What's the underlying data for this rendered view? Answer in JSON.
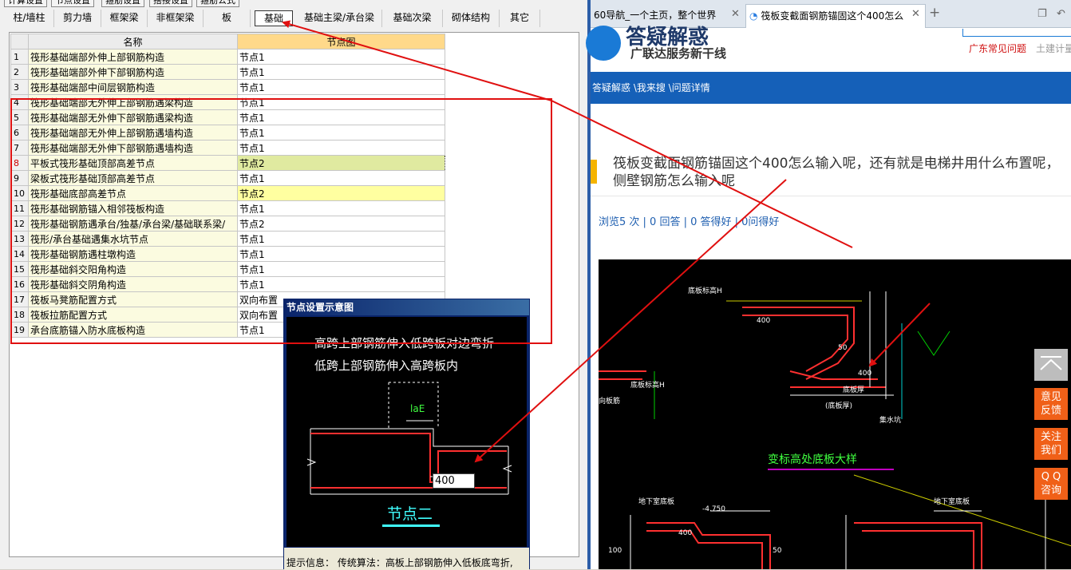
{
  "app": {
    "top_tabs": [
      "计算设置",
      "节点设置",
      "箍筋设置",
      "搭接设置",
      "箍筋公式"
    ],
    "category_tabs": [
      "柱/墙柱",
      "剪力墙",
      "框架梁",
      "非框架梁",
      "板",
      "基础",
      "基础主梁/承台梁",
      "基础次梁",
      "砌体结构",
      "其它"
    ],
    "active_category": "基础",
    "grid": {
      "col_name": "名称",
      "col_node": "节点图",
      "rows": [
        {
          "n": "1",
          "name": "筏形基础端部外伸上部钢筋构造",
          "val": "节点1"
        },
        {
          "n": "2",
          "name": "筏形基础端部外伸下部钢筋构造",
          "val": "节点1"
        },
        {
          "n": "3",
          "name": "筏形基础端部中间层钢筋构造",
          "val": "节点1"
        },
        {
          "n": "4",
          "name": "筏形基础端部无外伸上部钢筋遇梁构造",
          "val": "节点1"
        },
        {
          "n": "5",
          "name": "筏形基础端部无外伸下部钢筋遇梁构造",
          "val": "节点1"
        },
        {
          "n": "6",
          "name": "筏形基础端部无外伸上部钢筋遇墙构造",
          "val": "节点1"
        },
        {
          "n": "7",
          "name": "筏形基础端部无外伸下部钢筋遇墙构造",
          "val": "节点1"
        },
        {
          "n": "8",
          "name": "平板式筏形基础顶部高差节点",
          "val": "节点2"
        },
        {
          "n": "9",
          "name": "梁板式筏形基础顶部高差节点",
          "val": "节点1"
        },
        {
          "n": "10",
          "name": "筏形基础底部高差节点",
          "val": "节点2"
        },
        {
          "n": "11",
          "name": "筏形基础钢筋锚入相邻筏板构造",
          "val": "节点1"
        },
        {
          "n": "12",
          "name": "筏形基础钢筋遇承台/独基/承台梁/基础联系梁/",
          "val": "节点2"
        },
        {
          "n": "13",
          "name": "筏形/承台基础遇集水坑节点",
          "val": "节点1"
        },
        {
          "n": "14",
          "name": "筏形基础钢筋遇柱墩构造",
          "val": "节点1"
        },
        {
          "n": "15",
          "name": "筏形基础斜交阳角构造",
          "val": "节点1"
        },
        {
          "n": "16",
          "name": "筏形基础斜交阴角构造",
          "val": "节点1"
        },
        {
          "n": "17",
          "name": "筏板马凳筋配置方式",
          "val": "双向布置"
        },
        {
          "n": "18",
          "name": "筏板拉筋配置方式",
          "val": "双向布置"
        },
        {
          "n": "19",
          "name": "承台底筋锚入防水底板构造",
          "val": "节点1"
        }
      ]
    },
    "dialog": {
      "title": "节点设置示意图",
      "line1": "高跨上部钢筋伸入低跨板对边弯折",
      "line2": "低跨上部钢筋伸入高跨板内",
      "lae_label": "laE",
      "input_value": "400",
      "node_title": "节点二",
      "info": "提示信息：  传统算法：高板上部钢筋伸入低板底弯折,"
    }
  },
  "browser": {
    "tab1": "60导航_一个主页，整个世界",
    "tab2": "筏板变截面钢筋锚固这个400怎么",
    "logo_text": "答疑解惑",
    "slogan": "广联达服务新干线",
    "links": [
      "广东常见问题",
      "土建计量"
    ],
    "breadcrumb": "答疑解惑 \\我来搜 \\问题详情",
    "question": "筏板变截面钢筋锚固这个400怎么输入呢，还有就是电梯井用什么布置呢，侧壁钢筋怎么输入呢",
    "stats": "浏览5 次 | 0 回答 | 0 答得好 | 0问得好",
    "side_buttons": [
      "意见\n反馈",
      "关注\n我们",
      "Q Q\n咨询"
    ],
    "cad": {
      "labels": [
        "底板标高H",
        "400",
        "底板厚",
        "(底板厚)",
        "集水坑",
        "底板标高H",
        "400",
        "50",
        "向板筋",
        "变标高处底板大样",
        "地下室底板",
        "-4.750",
        "地下室底板",
        "400",
        "100",
        "50"
      ]
    }
  },
  "colors": {
    "annotation_red": "#e01010",
    "tab_blue": "#1560b8",
    "side_orange": "#f06018"
  }
}
